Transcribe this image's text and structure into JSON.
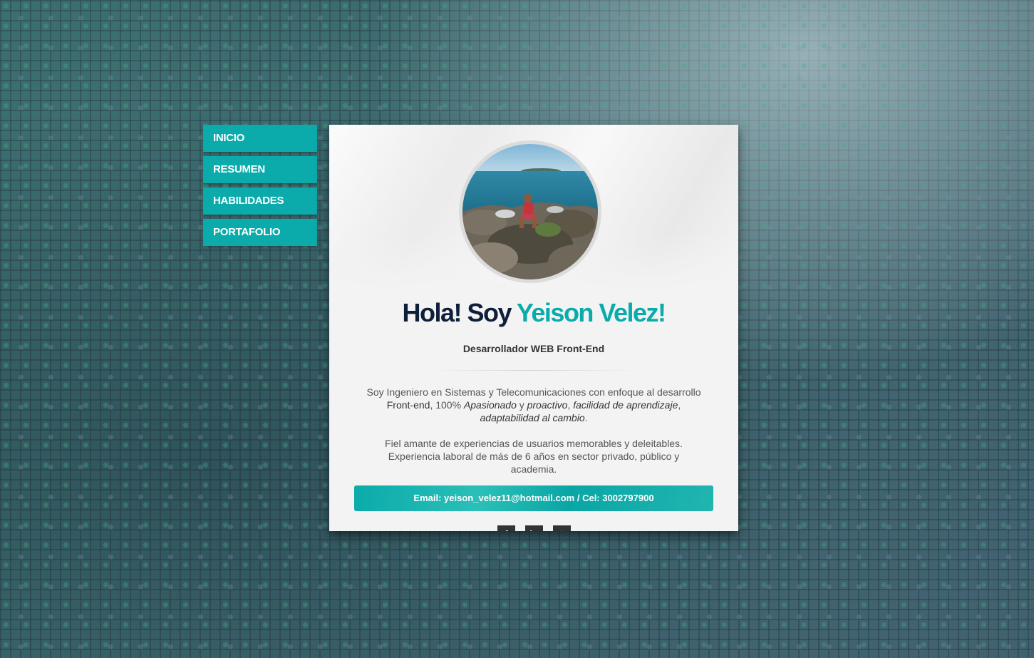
{
  "nav": {
    "items": [
      {
        "label": "INICIO"
      },
      {
        "label": "RESUMEN"
      },
      {
        "label": "HABILIDADES"
      },
      {
        "label": "PORTAFOLIO"
      }
    ]
  },
  "profile": {
    "greeting": "Hola! Soy",
    "name": "Yeison Velez!",
    "role": "Desarrollador WEB Front-End",
    "bio": {
      "p1_start": "Soy Ingeniero en Sistemas y Telecomunicaciones con enfoque al desarrollo ",
      "p1_frontend": "Front-end",
      "p1_mid": ", 100% ",
      "p1_apasionado": "Apasionado",
      "p1_y": " y ",
      "p1_proactivo": "proactivo",
      "p1_comma": ", ",
      "p1_facilidad": "facilidad de aprendizaje",
      "p1_comma2": ", ",
      "p1_adaptabilidad": "adaptabilidad al cambio",
      "p1_end": ".",
      "p2": "Fiel amante de experiencias de usuarios memorables y deleitables. Experiencia laboral de más de 6 años en sector privado, público y academia."
    },
    "contact": "Email: yeison_velez11@hotmail.com / Cel: 3002797900"
  },
  "social": [
    {
      "icon": "facebook-icon",
      "glyph": "f"
    },
    {
      "icon": "linkedin-icon",
      "glyph": "in"
    },
    {
      "icon": "twitter-icon",
      "glyph": "t"
    }
  ],
  "colors": {
    "accent": "#0aabaa",
    "heading": "#0f1f3a",
    "card": "#f3f3f3"
  }
}
